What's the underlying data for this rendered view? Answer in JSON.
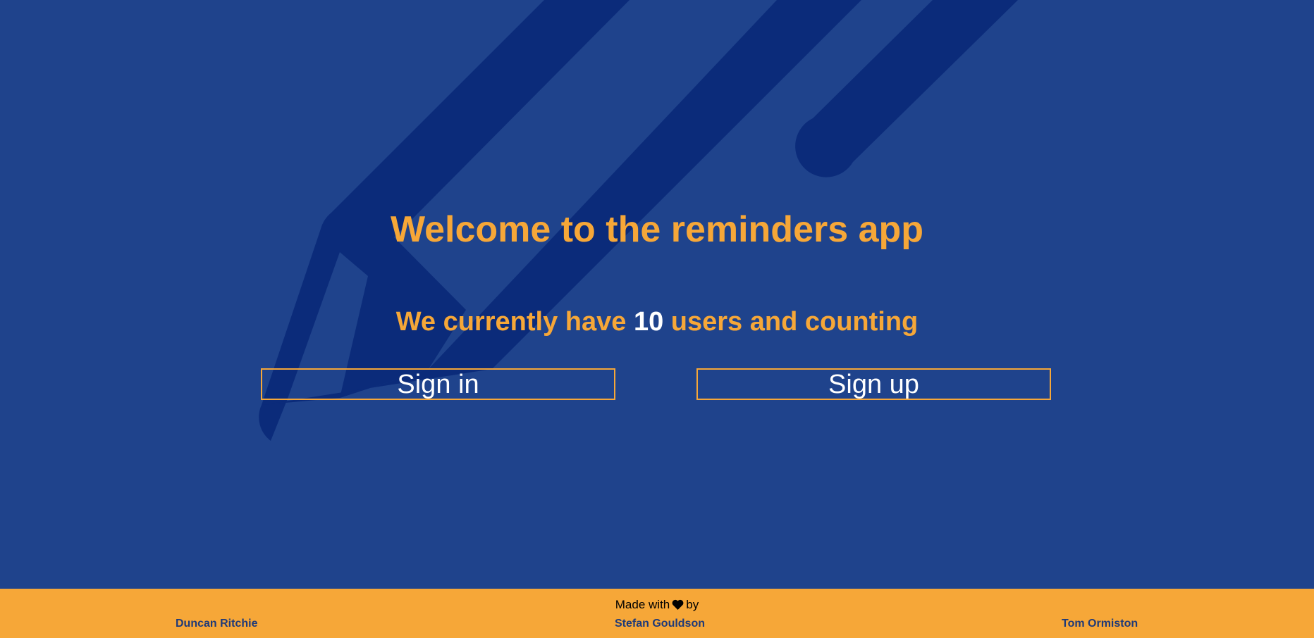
{
  "colors": {
    "background": "#1f438c",
    "background_art": "#0b2b7a",
    "accent": "#f6a738",
    "text_light": "#ffffff",
    "footer_text": "#1f3a78"
  },
  "hero": {
    "title": "Welcome to the reminders app",
    "subtitle_prefix": "We currently have",
    "user_count": "10",
    "subtitle_suffix": "users and counting"
  },
  "buttons": {
    "sign_in": "Sign in",
    "sign_up": "Sign up"
  },
  "background_icon": "pencil-icon",
  "footer": {
    "made_with_prefix": "Made with",
    "heart_icon": "heart-icon",
    "made_with_suffix": "by",
    "authors": [
      "Duncan Ritchie",
      "Stefan Gouldson",
      "Tom Ormiston"
    ]
  }
}
